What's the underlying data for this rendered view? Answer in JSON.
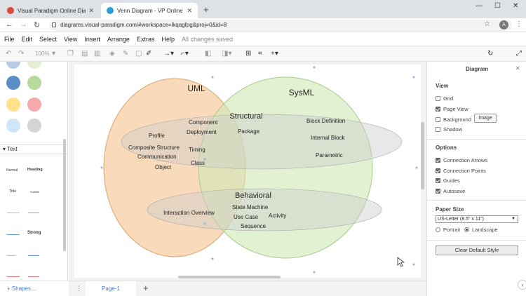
{
  "browser": {
    "tabs": [
      {
        "title": "Visual Paradigm Online Diagram",
        "favicon_color": "#d84a3a"
      },
      {
        "title": "Venn Diagram - VP Online",
        "favicon_color": "#2a9fd6"
      }
    ],
    "url": "diagrams.visual-paradigm.com/#workspace=lkqagfpg&proj=0&id=8",
    "avatar": "A"
  },
  "menu": [
    "File",
    "Edit",
    "Select",
    "View",
    "Insert",
    "Arrange",
    "Extras",
    "Help"
  ],
  "status": "All changes saved",
  "toolbar": {
    "zoom": "100%"
  },
  "left_panel": {
    "swatch_colors": [
      "#b7cde6",
      "#e4efcf",
      "#5b8ec9",
      "#b7d99b",
      "#ffe28a",
      "#f7a9ac",
      "#cfe6f8",
      "#d4d4d4"
    ],
    "text_section": "Text",
    "samples": [
      "Normal",
      "Heading",
      "Title",
      "Subtitle",
      "Strong"
    ],
    "shapes_button": "Shapes..."
  },
  "diagram": {
    "uml_label": "UML",
    "sysml_label": "SysML",
    "structural_label": "Structural",
    "behavioral_label": "Behavioral",
    "uml_structural": [
      "Profile",
      "Composite Structure",
      "Communication",
      "Object",
      "Component",
      "Deployment",
      "Timing",
      "Class"
    ],
    "shared_structural": [
      "Package"
    ],
    "sysml_structural": [
      "Block Definition",
      "Internal Block",
      "Parametric"
    ],
    "uml_behavioral": [
      "Interaction Overview"
    ],
    "shared_behavioral": [
      "State Machine",
      "Use Case",
      "Sequence",
      "Activity"
    ],
    "colors": {
      "uml": "#f6c897",
      "sysml": "#cfe8b4",
      "band": "#cdcdcd"
    }
  },
  "pages": {
    "current": "Page-1"
  },
  "right_panel": {
    "title": "Diagram",
    "view_section": "View",
    "view_options": [
      {
        "label": "Grid",
        "checked": false
      },
      {
        "label": "Page View",
        "checked": true
      },
      {
        "label": "Background",
        "checked": false
      },
      {
        "label": "Shadow",
        "checked": false
      }
    ],
    "image_button": "Image",
    "options_section": "Options",
    "options": [
      {
        "label": "Connection Arrows",
        "checked": true
      },
      {
        "label": "Connection Points",
        "checked": true
      },
      {
        "label": "Guides",
        "checked": true
      },
      {
        "label": "Autosave",
        "checked": true
      }
    ],
    "paper_section": "Paper Size",
    "paper_value": "US-Letter (8.5\" x 11\")",
    "orientation": [
      {
        "label": "Portrait",
        "selected": false
      },
      {
        "label": "Landscape",
        "selected": true
      }
    ],
    "clear_button": "Clear Default Style"
  }
}
